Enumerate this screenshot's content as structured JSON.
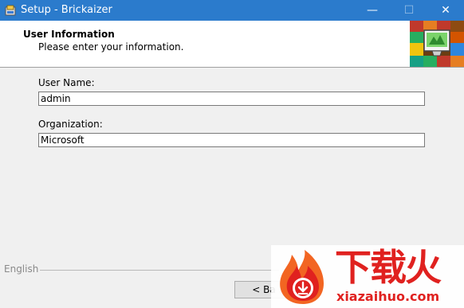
{
  "window": {
    "title": "Setup - Brickaizer",
    "minimize_glyph": "—",
    "maximize_glyph": "☐",
    "close_glyph": "✕"
  },
  "header": {
    "title": "User Information",
    "subtitle": "Please enter your information.",
    "image_icon": "lego-bricks-monitor-icon"
  },
  "form": {
    "user_name_label": "User Name:",
    "user_name_value": "admin",
    "organization_label": "Organization:",
    "organization_value": "Microsoft"
  },
  "footer": {
    "language": "English",
    "back_label": "< Ba"
  },
  "watermark": {
    "text": "下载火",
    "url": "xiazaihuo.com"
  },
  "colors": {
    "titlebar": "#2b7bcc",
    "watermark": "#e0211f"
  }
}
